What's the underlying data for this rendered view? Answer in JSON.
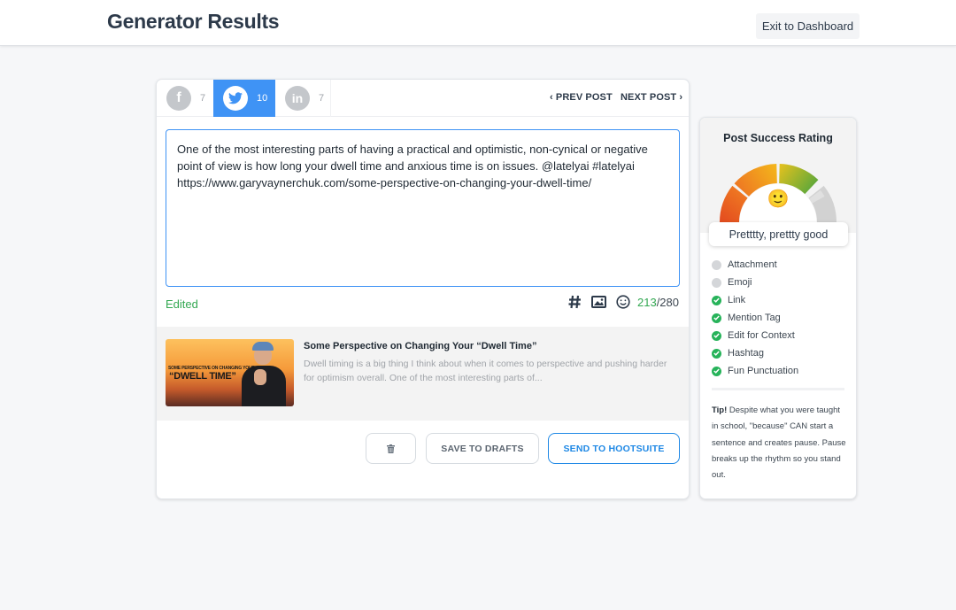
{
  "header": {
    "title": "Generator Results",
    "exit_label": "Exit to Dashboard"
  },
  "tabs": [
    {
      "network": "facebook",
      "icon": "f",
      "count": "7",
      "active": false
    },
    {
      "network": "twitter",
      "icon": "twitter-bird",
      "count": "10",
      "active": true
    },
    {
      "network": "linkedin",
      "icon": "in",
      "count": "7",
      "active": false
    }
  ],
  "nav": {
    "prev_label": "PREV POST",
    "next_label": "NEXT POST"
  },
  "editor": {
    "text": "One of the most interesting parts of having a practical and optimistic, non-cynical or negative point of view is how long your dwell time and anxious time is on issues. @latelyai #latelyai https://www.garyvaynerchuk.com/some-perspective-on-changing-your-dwell-time/",
    "status": "Edited",
    "char_used": "213",
    "char_limit": "/280",
    "tools": [
      "hashtag-icon",
      "image-icon",
      "emoji-icon"
    ]
  },
  "link_preview": {
    "thumb_small_text": "SOME PERSPECTIVE ON CHANGING YOUR",
    "thumb_big_text": "“DWELL TIME”",
    "title": "Some Perspective on Changing Your “Dwell Time”",
    "description": "Dwell timing is a big thing I think about when it comes to perspective and pushing harder for optimism overall. One of the most interesting parts of..."
  },
  "actions": {
    "delete_icon": "trash-icon",
    "save_label": "SAVE TO DRAFTS",
    "send_label": "SEND TO HOOTSUITE",
    "send_color": "#1e88e5"
  },
  "rating": {
    "title": "Post Success Rating",
    "score_fraction": 0.75,
    "emoji": "🙂",
    "label": "Pretttty, prettty good",
    "checklist": [
      {
        "label": "Attachment",
        "done": false
      },
      {
        "label": "Emoji",
        "done": false
      },
      {
        "label": "Link",
        "done": true
      },
      {
        "label": "Mention Tag",
        "done": true
      },
      {
        "label": "Edit for Context",
        "done": true
      },
      {
        "label": "Hashtag",
        "done": true
      },
      {
        "label": "Fun Punctuation",
        "done": true
      }
    ],
    "tip_label": "Tip!",
    "tip_text": " Despite what you were taught in school, \"because\" CAN start a sentence and creates pause. Pause breaks up the rhythm so you stand out."
  },
  "colors": {
    "accent": "#3f93f5",
    "success": "#33a852",
    "check_on": "#27b35a",
    "check_off": "#d4d6d9"
  }
}
